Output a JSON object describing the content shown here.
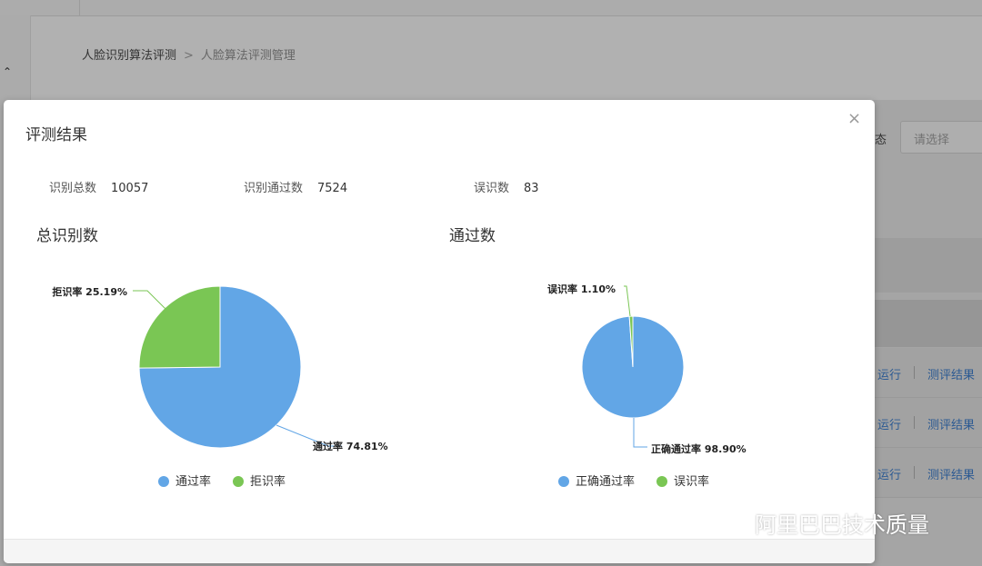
{
  "breadcrumb": {
    "parent": "人脸识别算法评测",
    "separator": ">",
    "current": "人脸算法评测管理"
  },
  "filter": {
    "status_label": "态",
    "select_placeholder": "请选择"
  },
  "table_actions": [
    {
      "run": "运行",
      "result": "测评结果"
    },
    {
      "run": "运行",
      "result": "测评结果"
    },
    {
      "run": "运行",
      "result": "测评结果"
    }
  ],
  "modal": {
    "title": "评测结果",
    "close_icon": "×",
    "stats": [
      {
        "label": "识别总数",
        "value": "10057"
      },
      {
        "label": "识别通过数",
        "value": "7524"
      },
      {
        "label": "误识数",
        "value": "83"
      }
    ]
  },
  "colors": {
    "blue": "#62a6e6",
    "green": "#7ac654"
  },
  "chart_data": [
    {
      "type": "pie",
      "title": "总识别数",
      "categories": [
        "通过率",
        "拒识率"
      ],
      "values": [
        74.81,
        25.19
      ],
      "data_labels": [
        "通过率 74.81%",
        "拒识率 25.19%"
      ],
      "colors": [
        "#62a6e6",
        "#7ac654"
      ],
      "legend": [
        "通过率",
        "拒识率"
      ],
      "legend_position": "bottom"
    },
    {
      "type": "pie",
      "title": "通过数",
      "categories": [
        "正确通过率",
        "误识率"
      ],
      "values": [
        98.9,
        1.1
      ],
      "data_labels": [
        "正确通过率 98.90%",
        "误识率 1.10%"
      ],
      "colors": [
        "#62a6e6",
        "#7ac654"
      ],
      "legend": [
        "正确通过率",
        "误识率"
      ],
      "legend_position": "bottom"
    }
  ],
  "watermark": {
    "text": "阿里巴巴技术质量"
  }
}
